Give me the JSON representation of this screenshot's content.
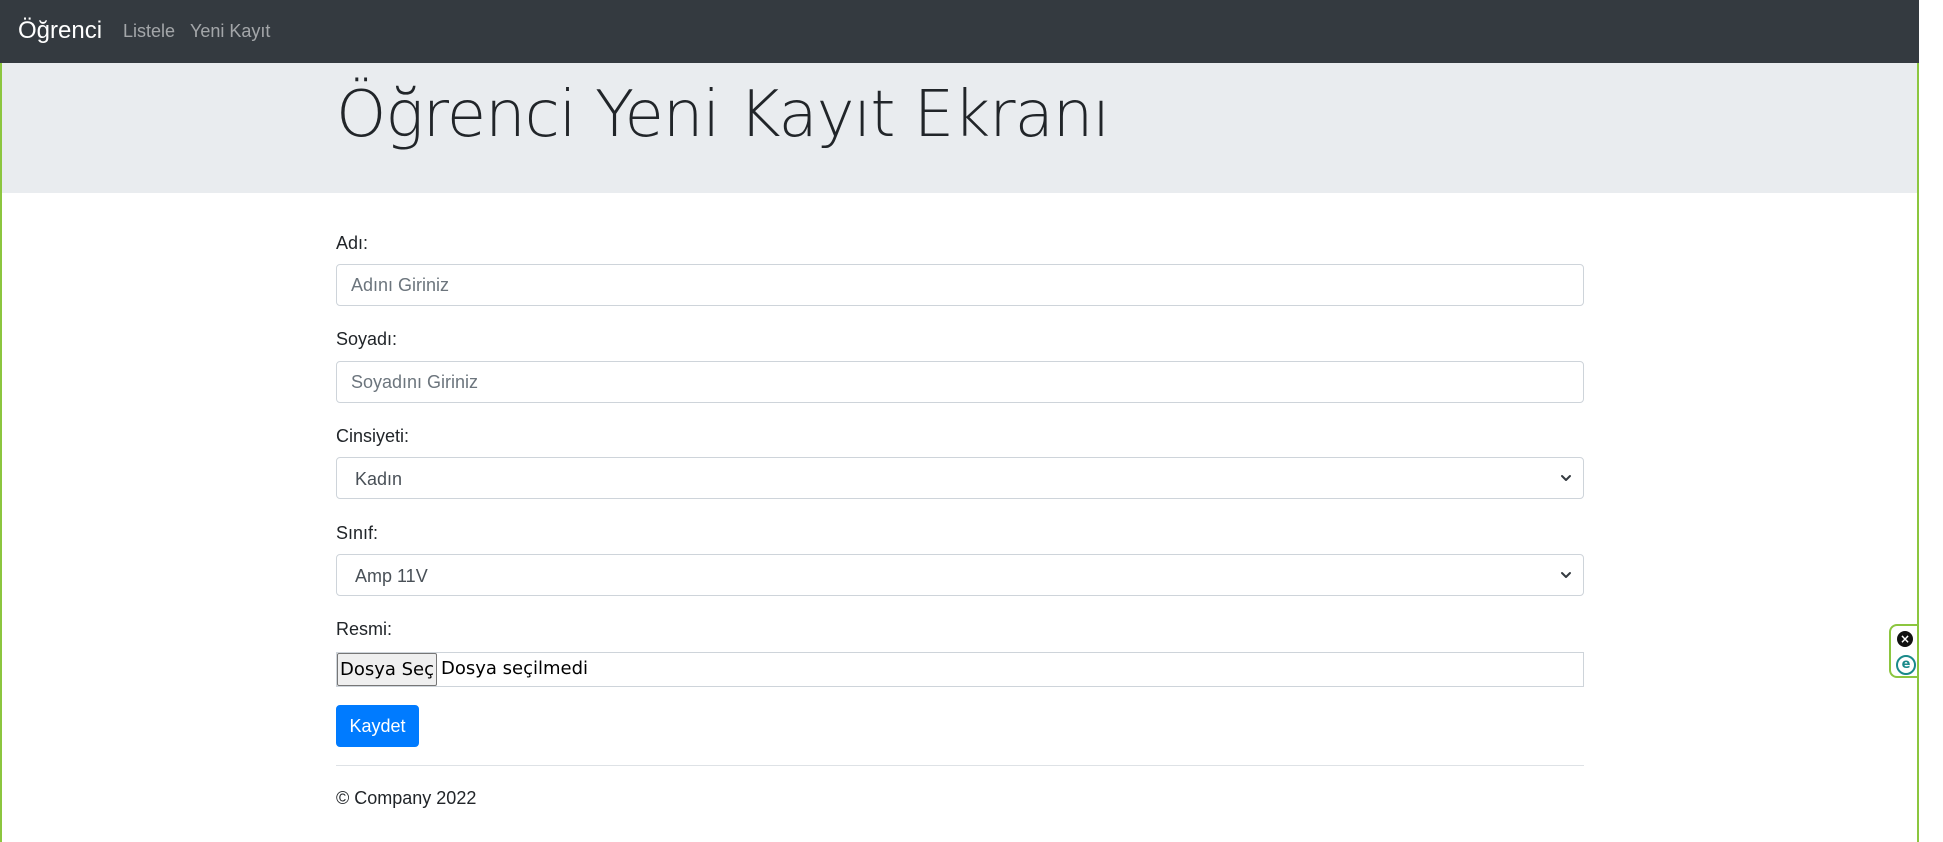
{
  "navbar": {
    "brand": "Öğrenci",
    "links": [
      "Listele",
      "Yeni Kayıt"
    ]
  },
  "page_title": "Öğrenci Yeni Kayıt Ekranı",
  "form": {
    "first_name": {
      "label": "Adı:",
      "placeholder": "Adını Giriniz",
      "value": ""
    },
    "last_name": {
      "label": "Soyadı:",
      "placeholder": "Soyadını Giriniz",
      "value": ""
    },
    "gender": {
      "label": "Cinsiyeti:",
      "selected": "Kadın"
    },
    "class": {
      "label": "Sınıf:",
      "selected": "Amp 11V"
    },
    "photo": {
      "label": "Resmi:",
      "button_label": "Dosya Seç",
      "status": "Dosya seçilmedi"
    },
    "submit_label": "Kaydet"
  },
  "footer": {
    "text": "© Company 2022"
  },
  "extension": {
    "icons": [
      "close-circle-icon",
      "e-icon"
    ],
    "accent": "#8cc63f"
  },
  "colors": {
    "navbar_bg": "#343a40",
    "jumbotron_bg": "#e9ecef",
    "primary": "#007bff"
  }
}
